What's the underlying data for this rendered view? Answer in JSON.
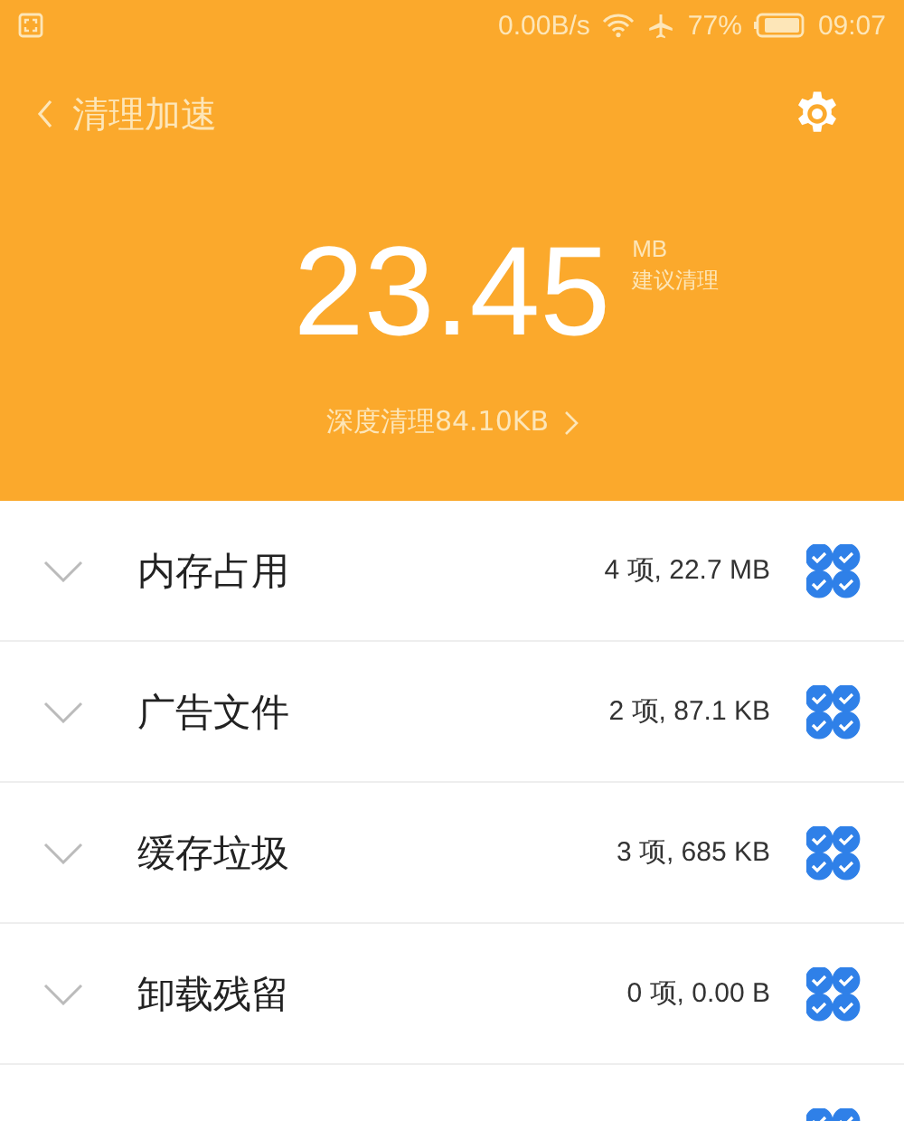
{
  "status_bar": {
    "speed": "0.00B/s",
    "battery": "77%",
    "time": "09:07"
  },
  "header": {
    "title": "清理加速",
    "amount": "23.45",
    "unit": "MB",
    "hint": "建议清理",
    "deep_clean": "深度清理84.10KB"
  },
  "categories": [
    {
      "name": "内存占用",
      "summary": "4 项, 22.7 MB",
      "checked": true
    },
    {
      "name": "广告文件",
      "summary": "2 项, 87.1 KB",
      "checked": true
    },
    {
      "name": "缓存垃圾",
      "summary": "3 项, 685 KB",
      "checked": true
    },
    {
      "name": "卸载残留",
      "summary": "0 项, 0.00 B",
      "checked": true
    },
    {
      "checked": true
    }
  ]
}
